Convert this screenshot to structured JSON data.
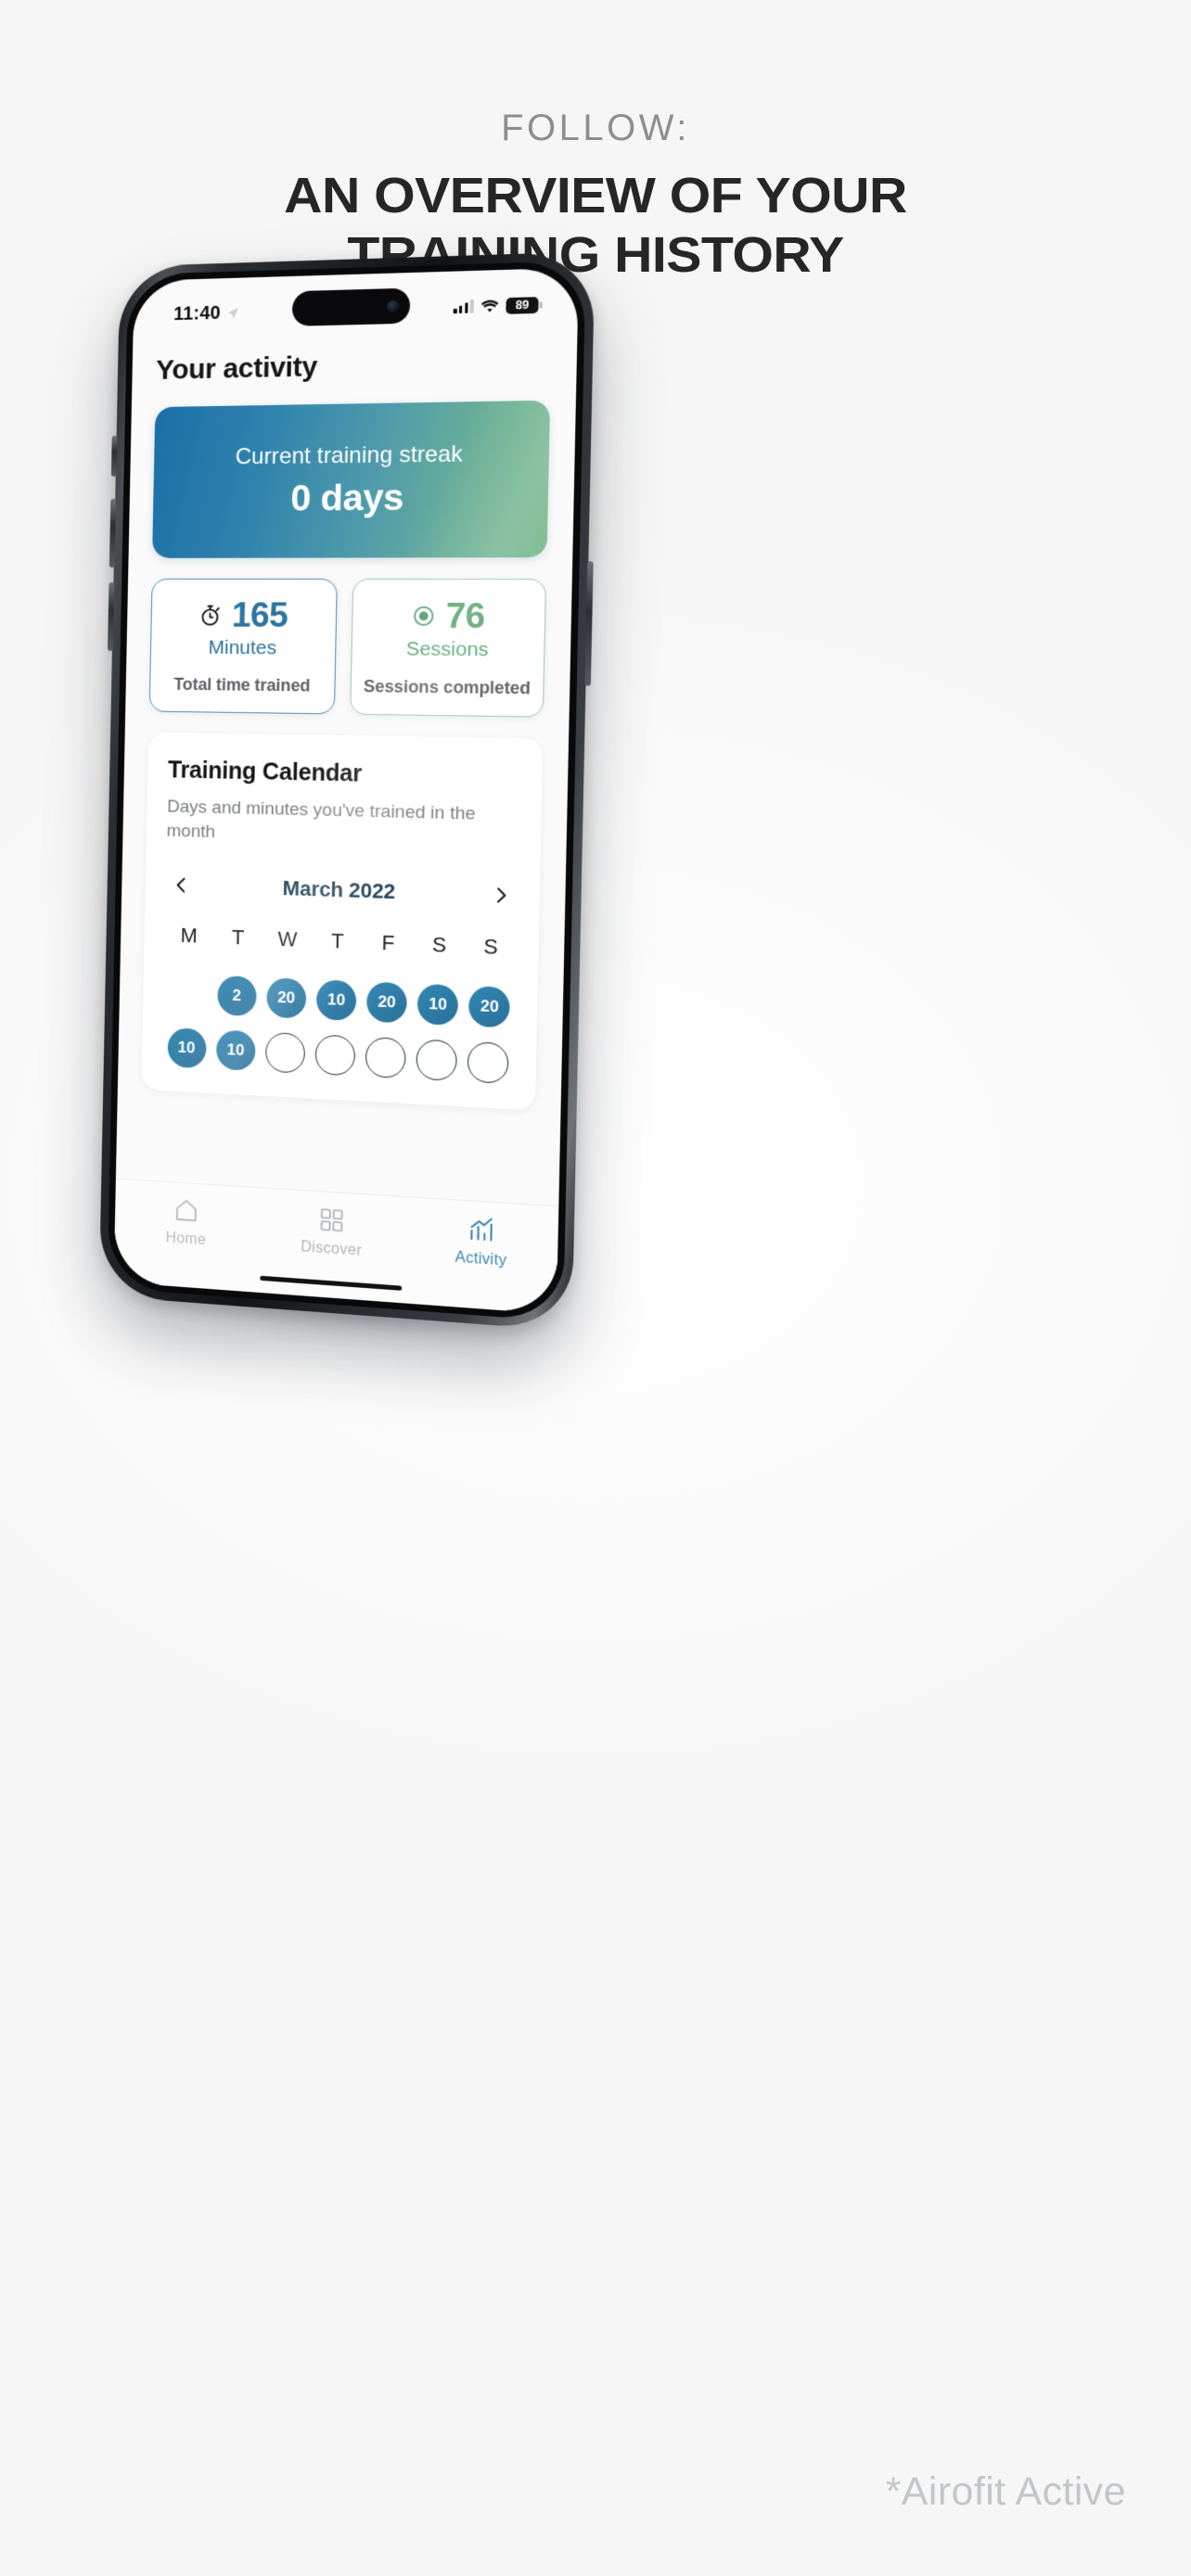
{
  "promo": {
    "eyebrow": "FOLLOW:",
    "title_line1": "AN OVERVIEW OF YOUR",
    "title_line2": "TRAINING HISTORY"
  },
  "watermark": "*Airofit Active",
  "status_bar": {
    "time": "11:40",
    "location_icon": "location-arrow-icon",
    "signal_icon": "cellular-signal-icon",
    "wifi_icon": "wifi-icon",
    "battery_level": "89"
  },
  "app": {
    "page_title": "Your activity",
    "streak_card": {
      "label": "Current training streak",
      "value": "0 days",
      "gradient_from": "#1a6fa8",
      "gradient_to": "#79b98c"
    },
    "stats": [
      {
        "icon": "stopwatch-icon",
        "number": "165",
        "unit": "Minutes",
        "caption": "Total time trained",
        "accent": "#2c74a0"
      },
      {
        "icon": "target-dot-icon",
        "number": "76",
        "unit": "Sessions",
        "caption": "Sessions completed",
        "accent": "#58a36f"
      }
    ],
    "calendar": {
      "title": "Training Calendar",
      "subtitle": "Days and minutes you've trained in the month",
      "prev_icon": "chevron-left-icon",
      "next_icon": "chevron-right-icon",
      "month": "March 2022",
      "weekdays": [
        "M",
        "T",
        "W",
        "T",
        "F",
        "S",
        "S"
      ],
      "days": [
        {
          "value": "",
          "state": "blank"
        },
        {
          "value": "2",
          "state": "filled"
        },
        {
          "value": "20",
          "state": "filled"
        },
        {
          "value": "10",
          "state": "filled"
        },
        {
          "value": "20",
          "state": "filled"
        },
        {
          "value": "10",
          "state": "filled"
        },
        {
          "value": "20",
          "state": "filled"
        },
        {
          "value": "10",
          "state": "filled"
        },
        {
          "value": "10",
          "state": "filled"
        },
        {
          "value": "",
          "state": "empty"
        },
        {
          "value": "",
          "state": "empty"
        },
        {
          "value": "",
          "state": "empty"
        },
        {
          "value": "",
          "state": "empty"
        },
        {
          "value": "",
          "state": "empty"
        }
      ]
    },
    "tabs": [
      {
        "label": "Home",
        "icon": "home-icon",
        "active": false
      },
      {
        "label": "Discover",
        "icon": "grid-squares-icon",
        "active": false
      },
      {
        "label": "Activity",
        "icon": "bar-chart-icon",
        "active": true
      }
    ]
  }
}
